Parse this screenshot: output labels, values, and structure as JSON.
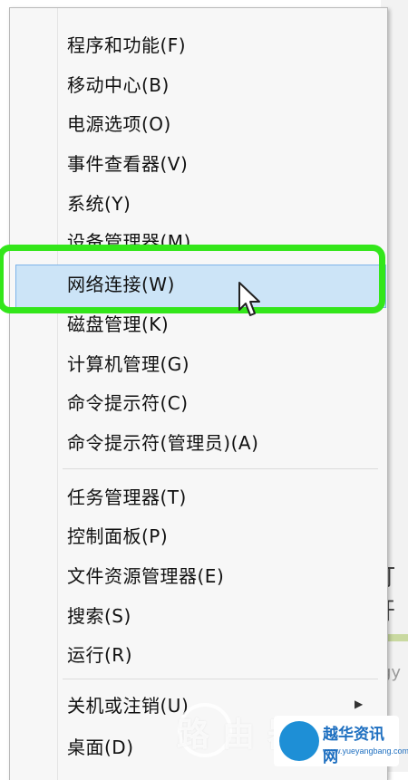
{
  "menu": {
    "items": [
      {
        "label": "程序和功能(F)"
      },
      {
        "label": "移动中心(B)"
      },
      {
        "label": "电源选项(O)"
      },
      {
        "label": "事件查看器(V)"
      },
      {
        "label": "系统(Y)"
      },
      {
        "label": "设备管理器(M)"
      },
      {
        "label": "网络连接(W)"
      },
      {
        "label": "磁盘管理(K)"
      },
      {
        "label": "计算机管理(G)"
      },
      {
        "label": "命令提示符(C)"
      },
      {
        "label": "命令提示符(管理员)(A)"
      },
      {
        "label": "任务管理器(T)"
      },
      {
        "label": "控制面板(P)"
      },
      {
        "label": "文件资源管理器(E)"
      },
      {
        "label": "搜索(S)"
      },
      {
        "label": "运行(R)"
      },
      {
        "label": "关机或注销(U)"
      },
      {
        "label": "桌面(D)"
      }
    ],
    "highlighted_item": "网络连接(W)",
    "highlight_ring_color": "#33e61a",
    "hover_color": "#cce4f7"
  },
  "background": {
    "partial_text": "打开",
    "partial_text_2": "gy"
  },
  "watermark": {
    "text": "路由器",
    "badge_title": "越华资讯网",
    "badge_url": "www.yueyangbang.com"
  }
}
